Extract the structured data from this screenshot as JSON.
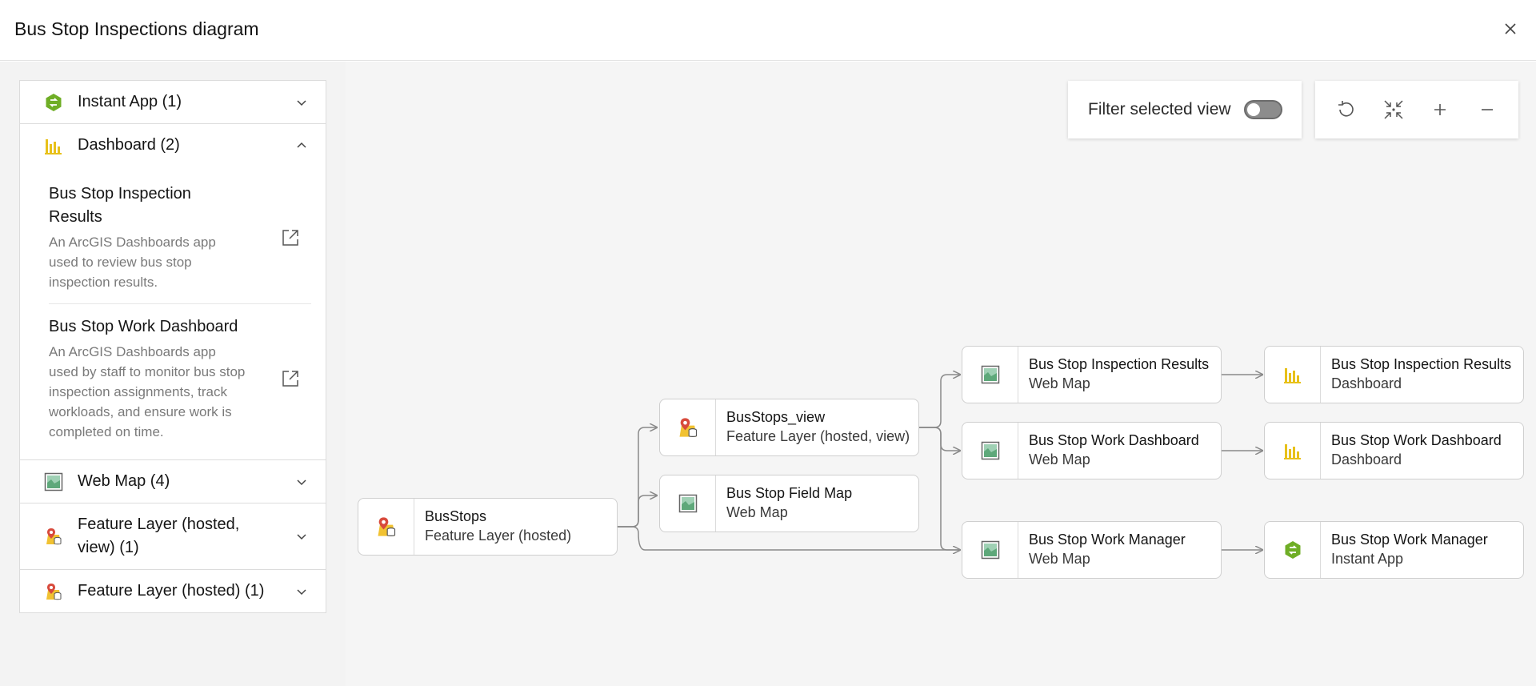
{
  "header": {
    "title": "Bus Stop Inspections diagram"
  },
  "sidebar": {
    "groups": [
      {
        "label": "Instant App (1)",
        "icon": "instant-app-icon"
      },
      {
        "label": "Dashboard (2)",
        "icon": "dashboard-icon",
        "expanded": true,
        "items": [
          {
            "title": "Bus Stop Inspection Results",
            "description": "An ArcGIS Dashboards app used to review bus stop inspection results."
          },
          {
            "title": "Bus Stop Work Dashboard",
            "description": "An ArcGIS Dashboards app used by staff to monitor bus stop inspection assignments, track workloads, and ensure work is completed on time."
          }
        ]
      },
      {
        "label": "Web Map (4)",
        "icon": "web-map-icon"
      },
      {
        "label": "Feature Layer (hosted, view) (1)",
        "icon": "feature-layer-icon"
      },
      {
        "label": "Feature Layer (hosted) (1)",
        "icon": "feature-layer-icon"
      }
    ]
  },
  "canvas": {
    "filter_label": "Filter selected view",
    "filter_enabled": false,
    "tools": [
      "reset-icon",
      "fit-icon",
      "zoom-in-icon",
      "zoom-out-icon"
    ],
    "nodes": [
      {
        "title": "BusStops",
        "type": "Feature Layer (hosted)",
        "icon": "feature-layer-icon"
      },
      {
        "title": "BusStops_view",
        "type": "Feature Layer (hosted, view)",
        "icon": "feature-layer-icon"
      },
      {
        "title": "Bus Stop Field Map",
        "type": "Web Map",
        "icon": "web-map-icon"
      },
      {
        "title": "Bus Stop Inspection Results",
        "type": "Web Map",
        "icon": "web-map-icon"
      },
      {
        "title": "Bus Stop Work Dashboard",
        "type": "Web Map",
        "icon": "web-map-icon"
      },
      {
        "title": "Bus Stop Work Manager",
        "type": "Web Map",
        "icon": "web-map-icon"
      },
      {
        "title": "Bus Stop Inspection Results",
        "type": "Dashboard",
        "icon": "dashboard-icon"
      },
      {
        "title": "Bus Stop Work Dashboard",
        "type": "Dashboard",
        "icon": "dashboard-icon"
      },
      {
        "title": "Bus Stop Work Manager",
        "type": "Instant App",
        "icon": "instant-app-icon"
      }
    ]
  },
  "colors": {
    "instant_app": "#6fae26",
    "dashboard": "#e8c11a",
    "web_map": "#5ea87a",
    "feature_layer_pin": "#d84a3c",
    "feature_layer_base": "#f1c232",
    "link": "#8a8a8a"
  }
}
